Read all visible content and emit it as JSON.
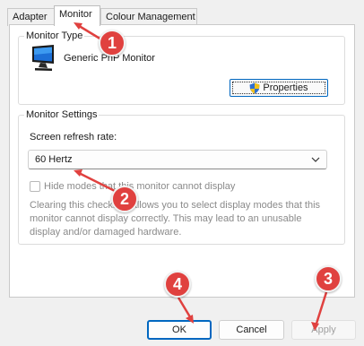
{
  "tabs": [
    {
      "label": "Adapter",
      "active": false
    },
    {
      "label": "Monitor",
      "active": true
    },
    {
      "label": "Colour Management",
      "active": false
    }
  ],
  "monitor_type": {
    "group_title": "Monitor Type",
    "monitor_name": "Generic PnP Monitor",
    "properties_label": "Properties",
    "icon": "monitor-icon"
  },
  "monitor_settings": {
    "group_title": "Monitor Settings",
    "refresh_label": "Screen refresh rate:",
    "refresh_value": "60 Hertz",
    "hide_modes_label": "Hide modes that this monitor cannot display",
    "hide_modes_checked": false,
    "hide_modes_enabled": false,
    "description": "Clearing this checkbox allows you to select display modes that this monitor cannot display correctly. This may lead to an unusable display and/or damaged hardware."
  },
  "buttons": {
    "ok": "OK",
    "cancel": "Cancel",
    "apply": "Apply"
  },
  "annotations": [
    "1",
    "2",
    "3",
    "4"
  ],
  "colors": {
    "accent": "#0067c0",
    "badge": "#e0413f"
  }
}
